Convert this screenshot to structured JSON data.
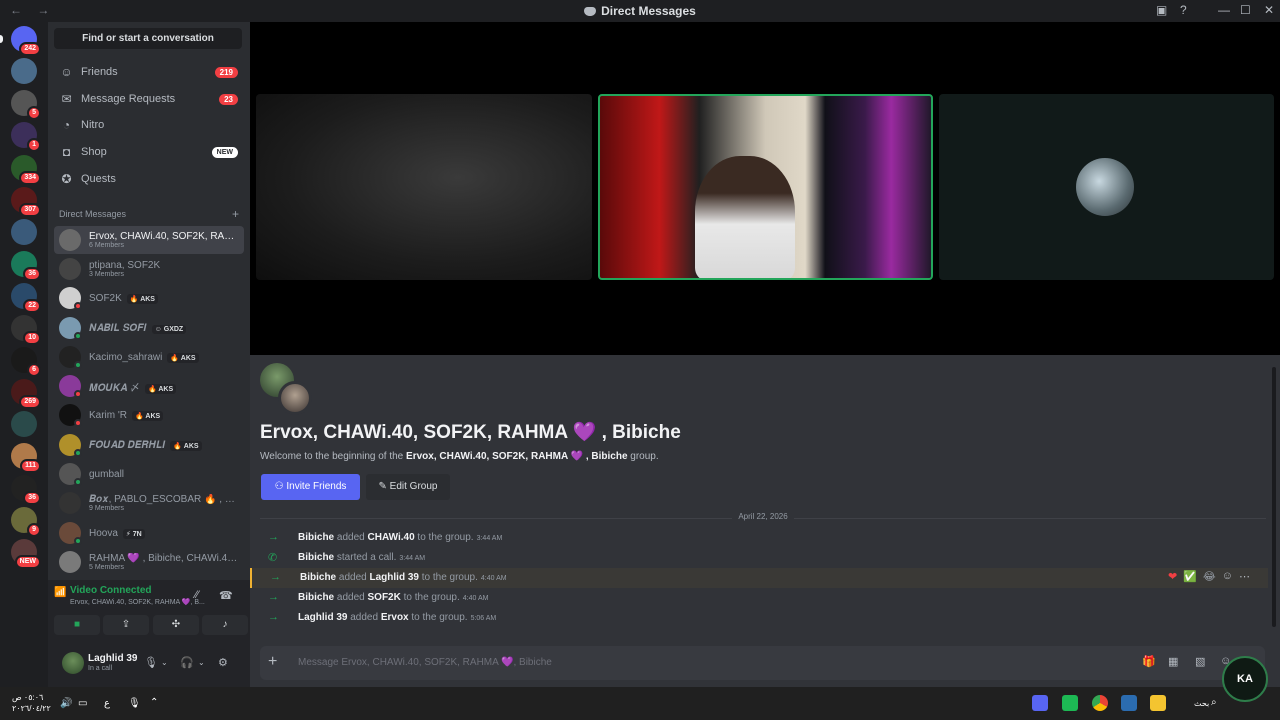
{
  "titlebar": {
    "title": "Direct Messages",
    "nav": "← →"
  },
  "guilds": [
    {
      "badge": "242",
      "color": "#5865f2"
    },
    {
      "badge": "",
      "color": "#4a6b8a"
    },
    {
      "badge": "5",
      "color": "#555"
    },
    {
      "badge": "1",
      "color": "#3c2f5a"
    },
    {
      "badge": "334",
      "color": "#2a5a2a"
    },
    {
      "badge": "307",
      "color": "#5a1a1a"
    },
    {
      "badge": "",
      "color": "#3a5a7a"
    },
    {
      "badge": "36",
      "color": "#1a7a5a"
    },
    {
      "badge": "22",
      "color": "#2a4a6a"
    },
    {
      "badge": "10",
      "color": "#333"
    },
    {
      "badge": "6",
      "color": "#1a1a1a"
    },
    {
      "badge": "269",
      "color": "#4a1a1a"
    },
    {
      "badge": "",
      "color": "#2a4a4a"
    },
    {
      "badge": "111",
      "color": "#b07a4a"
    },
    {
      "badge": "36",
      "color": "#222"
    },
    {
      "badge": "9",
      "color": "#6a6a3a"
    },
    {
      "badge": "NEW",
      "color": "#5a3a3a"
    }
  ],
  "sidebar": {
    "find": "Find or start a conversation",
    "nav": [
      {
        "label": "Friends",
        "icon": "friends-icon",
        "glyph": "☺",
        "count": "219"
      },
      {
        "label": "Message Requests",
        "icon": "mail-icon",
        "glyph": "✉",
        "count": "23"
      },
      {
        "label": "Nitro",
        "icon": "nitro-icon",
        "glyph": "◔",
        "count": ""
      },
      {
        "label": "Shop",
        "icon": "shop-icon",
        "glyph": "◘",
        "new": "NEW"
      },
      {
        "label": "Quests",
        "icon": "quests-icon",
        "glyph": "✪",
        "count": ""
      }
    ],
    "dm_header": "Direct Messages",
    "dms": [
      {
        "name": "Ervox, CHAWi.40, SOF2K, RAH...",
        "sub": "6 Members",
        "tag": "",
        "color": "#6a6a6a",
        "status": ""
      },
      {
        "name": "ptipana, SOF2K",
        "sub": "3 Members",
        "tag": "",
        "color": "#444",
        "status": ""
      },
      {
        "name": "SOF2K",
        "sub": "",
        "tag": "🔥 AKS",
        "color": "#cfcfcf",
        "status": "#f23f43"
      },
      {
        "name": "𝑵𝑨𝑩𝑰𝑳 𝑺𝑶𝑭𝑰",
        "sub": "",
        "tag": "☺ GXDZ",
        "color": "#7a9ab0",
        "status": "#23a55a"
      },
      {
        "name": "Kacimo_sahrawi",
        "sub": "",
        "tag": "🔥 AKS",
        "color": "#222",
        "status": "#23a55a"
      },
      {
        "name": "𝑴𝑶𝑼𝑲𝑨 〆",
        "sub": "",
        "tag": "🔥 AKS",
        "color": "#8a3a9a",
        "status": "#f23f43"
      },
      {
        "name": "Karim 'R",
        "sub": "",
        "tag": "🔥 AKS",
        "color": "#111",
        "status": "#f23f43"
      },
      {
        "name": "𝑭𝑶𝑼𝑨𝑫 𝑫𝑬𝑹𝑯𝑳𝑰",
        "sub": "",
        "tag": "🔥 AKS",
        "color": "#b0902a",
        "status": "#23a55a"
      },
      {
        "name": "gumball",
        "sub": "",
        "tag": "",
        "color": "#555",
        "status": "#23a55a"
      },
      {
        "name": "𝑩𝒐𝒙, PABLO_ESCOBAR 🔥 , Ra...",
        "sub": "9 Members",
        "tag": "",
        "color": "#333",
        "status": ""
      },
      {
        "name": "Hoova",
        "sub": "",
        "tag": "⚡ 7N",
        "color": "#6a4a3a",
        "status": "#23a55a"
      },
      {
        "name": "RAHMA 💜 , Bibiche, CHAWi.40,...",
        "sub": "5 Members",
        "tag": "",
        "color": "#7a7a7a",
        "status": ""
      }
    ]
  },
  "voice": {
    "status": "Video Connected",
    "channel": "Ervox, CHAWi.40, SOF2K, RAHMA 💜, B..."
  },
  "user": {
    "name": "Laghlid 39",
    "status": "In a call"
  },
  "welcome": {
    "title": "Ervox, CHAWi.40, SOF2K, RAHMA 💜 , Bibiche",
    "pre": "Welcome to the beginning of the ",
    "group_name": "Ervox, CHAWi.40, SOF2K, RAHMA 💜 , Bibiche",
    "post": " group.",
    "invite": "Invite Friends",
    "edit": "Edit Group"
  },
  "date_divider": "April 22, 2026",
  "messages": [
    {
      "actor": "Bibiche",
      "action": " added ",
      "target": "CHAWi.40",
      "tail": " to the group.",
      "time": "3:44 AM",
      "icon": "arrow-right-icon"
    },
    {
      "actor": "Bibiche",
      "action": " started a call.",
      "target": "",
      "tail": "",
      "time": "3:44 AM",
      "icon": "phone-icon"
    },
    {
      "actor": "Bibiche",
      "action": " added ",
      "target": "Laghlid 39",
      "tail": " to the group.",
      "time": "4:40 AM",
      "icon": "arrow-right-icon"
    },
    {
      "actor": "Bibiche",
      "action": " added ",
      "target": "SOF2K",
      "tail": " to the group.",
      "time": "4:40 AM",
      "icon": "arrow-right-icon"
    },
    {
      "actor": "Laghlid 39",
      "action": " added ",
      "target": "Ervox",
      "tail": " to the group.",
      "time": "5:06 AM",
      "icon": "arrow-right-icon"
    }
  ],
  "reactions": [
    "❤",
    "✅",
    "😂",
    "☺",
    "⋯"
  ],
  "composer": {
    "placeholder": "Message Ervox, CHAWi.40, SOF2K, RAHMA 💜, Bibiche"
  },
  "taskbar": {
    "time": "٠٥:٠٦ ص",
    "date": "٢٠٢٦/٠٤/٢٢",
    "lang": "ع",
    "search": "بحث"
  }
}
